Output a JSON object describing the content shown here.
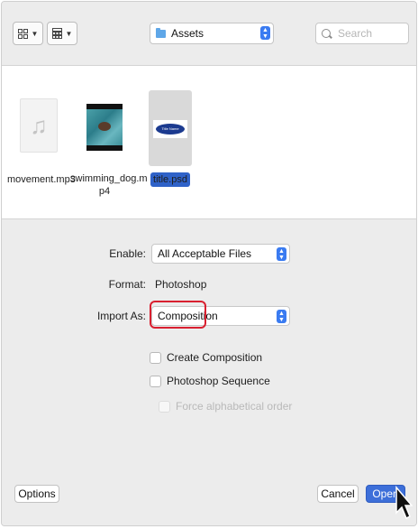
{
  "toolbar": {
    "icon_view_icon": "grid-icon",
    "group_view_icon": "list-grid-icon",
    "location": "Assets",
    "search_placeholder": "Search"
  },
  "files": [
    {
      "name": "movement.mp3",
      "type": "audio",
      "icon": "music-note-icon"
    },
    {
      "name_line1": "swimming_dog.m",
      "name_line2": "p4",
      "type": "video"
    },
    {
      "name": "title.psd",
      "type": "psd",
      "selected": true
    }
  ],
  "form": {
    "enable_label": "Enable:",
    "enable_value": "All Acceptable Files",
    "format_label": "Format:",
    "format_value": "Photoshop",
    "import_label": "Import As:",
    "import_value": "Composition",
    "create_composition": "Create Composition",
    "photoshop_sequence": "Photoshop Sequence",
    "force_alphabetical": "Force alphabetical order"
  },
  "footer": {
    "options": "Options",
    "cancel": "Cancel",
    "open": "Open"
  },
  "colors": {
    "accent": "#3d6fd9",
    "highlight_ring": "#d92030"
  }
}
